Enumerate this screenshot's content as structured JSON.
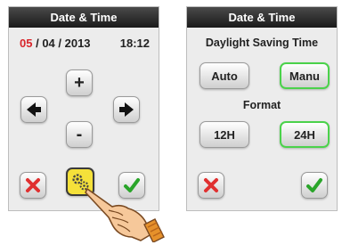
{
  "left_screen": {
    "title": "Date & Time",
    "date_day": "05",
    "date_rest": "/ 04 / 2013",
    "time": "18:12",
    "plus_label": "+",
    "minus_label": "-",
    "icons": {
      "left": "arrow-left-icon",
      "right": "arrow-right-icon",
      "cancel": "close-icon",
      "settings": "gear-icon",
      "confirm": "check-icon",
      "pointer": "hand-pointer-icon"
    }
  },
  "right_screen": {
    "title": "Date & Time",
    "dst_label": "Daylight Saving Time",
    "auto_label": "Auto",
    "manu_label": "Manu",
    "format_label": "Format",
    "h12_label": "12H",
    "h24_label": "24H",
    "icons": {
      "cancel": "close-icon",
      "confirm": "check-icon"
    }
  },
  "colors": {
    "accent_red": "#d8262c",
    "selected_border": "#4bd24b",
    "confirm_green": "#2aa52a",
    "gear_yellow": "#f5e13a"
  }
}
